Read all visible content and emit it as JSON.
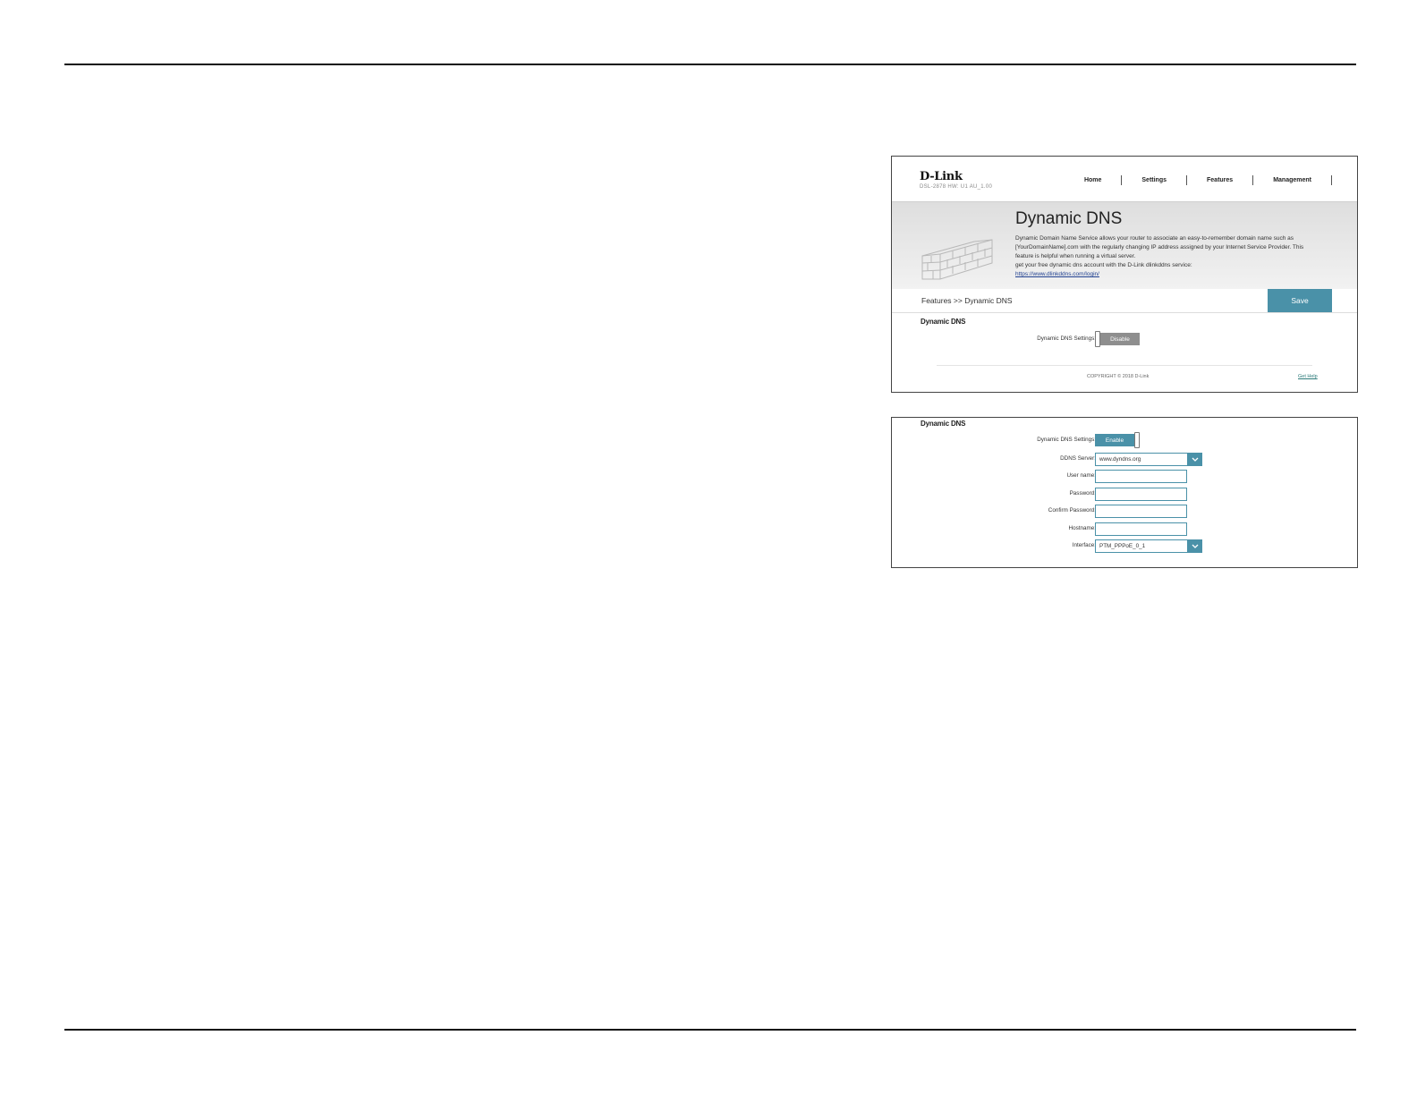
{
  "screenshot1": {
    "brand": {
      "logo": "D-Link",
      "model": "DSL-2878  HW: U1  AU_1.00"
    },
    "nav": [
      "Home",
      "Settings",
      "Features",
      "Management"
    ],
    "hero": {
      "title": "Dynamic DNS",
      "desc_lines": [
        "Dynamic Domain Name Service allows your router to associate an easy-to-remember domain name such as",
        "[YourDomainName].com with the regularly changing IP address assigned by your Internet Service Provider. This",
        "feature is helpful when running a virtual server.",
        "get your free dynamic dns account with the D-Link dlinkddns service:"
      ],
      "link": "https://www.dlinkddns.com/login/"
    },
    "breadcrumb": "Features >> Dynamic DNS",
    "save_label": "Save",
    "section_title": "Dynamic DNS",
    "ddns_label": "Dynamic DNS Settings:",
    "toggle_state": "Disable",
    "footer": {
      "copyright": "COPYRIGHT © 2018 D-Link",
      "help": "Get Help"
    }
  },
  "screenshot2": {
    "section_title": "Dynamic DNS",
    "ddns_label": "Dynamic DNS Settings:",
    "toggle_state": "Enable",
    "fields": {
      "ddns_server": {
        "label": "DDNS Server:",
        "value": "www.dyndns.org"
      },
      "username": {
        "label": "User name:",
        "value": ""
      },
      "password": {
        "label": "Password:",
        "value": ""
      },
      "confirm_password": {
        "label": "Confirm Password:",
        "value": ""
      },
      "hostname": {
        "label": "Hostname:",
        "value": ""
      },
      "interface": {
        "label": "Interface:",
        "value": "PTM_PPPoE_0_1"
      }
    }
  },
  "colors": {
    "accent": "#4a91a8",
    "disable_gray": "#8e8e8e",
    "link": "#1f3f8f"
  }
}
